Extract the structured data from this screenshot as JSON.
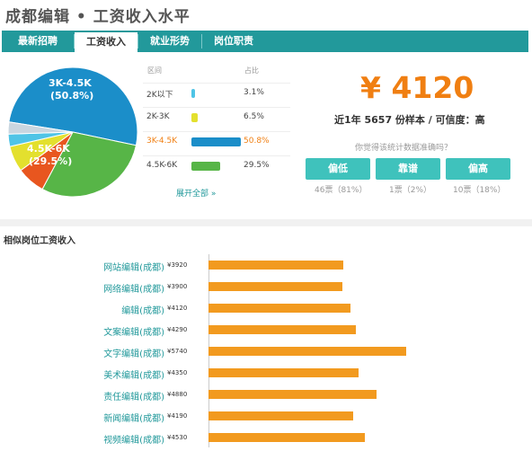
{
  "header": {
    "title": "成都编辑 • 工资收入水平"
  },
  "tabs": [
    "最新招聘",
    "工资收入",
    "就业形势",
    "岗位职责"
  ],
  "colors": {
    "teal": "#22999b",
    "orange": "#f07f12",
    "bar": "#f29a1f"
  },
  "distribution": {
    "col_range": "区间",
    "col_pct": "占比",
    "rows": [
      {
        "range": "2K以下",
        "percent": "3.1%",
        "fraction": 0.031,
        "color": "#4fc4e6",
        "label_color": "#444"
      },
      {
        "range": "2K-3K",
        "percent": "6.5%",
        "fraction": 0.065,
        "color": "#e3e02e",
        "label_color": "#444"
      },
      {
        "range": "3K-4.5K",
        "percent": "50.8%",
        "fraction": 0.508,
        "color": "#1b8ec9",
        "label_color": "#f07f12"
      },
      {
        "range": "4.5K-6K",
        "percent": "29.5%",
        "fraction": 0.295,
        "color": "#57b547",
        "label_color": "#444"
      }
    ],
    "more": "展开全部 »"
  },
  "pie": {
    "label1_range": "3K-4.5K",
    "label1_pct": "(50.8%)",
    "label2_range": "4.5K-6K",
    "label2_pct": "(29.5%)",
    "slices": [
      {
        "fraction": 0.508,
        "color": "#1b8ec9"
      },
      {
        "fraction": 0.295,
        "color": "#57b547"
      },
      {
        "fraction": 0.071,
        "color": "#e8561f"
      },
      {
        "fraction": 0.065,
        "color": "#e3e02e"
      },
      {
        "fraction": 0.031,
        "color": "#4fc4e6"
      },
      {
        "fraction": 0.03,
        "color": "#c9d6e0"
      }
    ]
  },
  "summary": {
    "price": "¥ 4120",
    "sample": "近1年 5657 份样本 / 可信度：高",
    "question": "你觉得该统计数据准确吗？",
    "votes": [
      {
        "label": "偏低",
        "count": "46票（81%）"
      },
      {
        "label": "靠谱",
        "count": "1票（2%）"
      },
      {
        "label": "偏高",
        "count": "10票（18%）"
      }
    ]
  },
  "similar": {
    "title": "相似岗位工资收入",
    "rows": [
      {
        "name": "网站编辑(成都)",
        "value_label": "¥3920",
        "value": 3920
      },
      {
        "name": "网络编辑(成都)",
        "value_label": "¥3900",
        "value": 3900
      },
      {
        "name": "编辑(成都)",
        "value_label": "¥4120",
        "value": 4120
      },
      {
        "name": "文案编辑(成都)",
        "value_label": "¥4290",
        "value": 4290
      },
      {
        "name": "文字编辑(成都)",
        "value_label": "¥5740",
        "value": 5740
      },
      {
        "name": "美术编辑(成都)",
        "value_label": "¥4350",
        "value": 4350
      },
      {
        "name": "责任编辑(成都)",
        "value_label": "¥4880",
        "value": 4880
      },
      {
        "name": "新闻编辑(成都)",
        "value_label": "¥4190",
        "value": 4190
      },
      {
        "name": "视频编辑(成都)",
        "value_label": "¥4530",
        "value": 4530
      }
    ]
  }
}
